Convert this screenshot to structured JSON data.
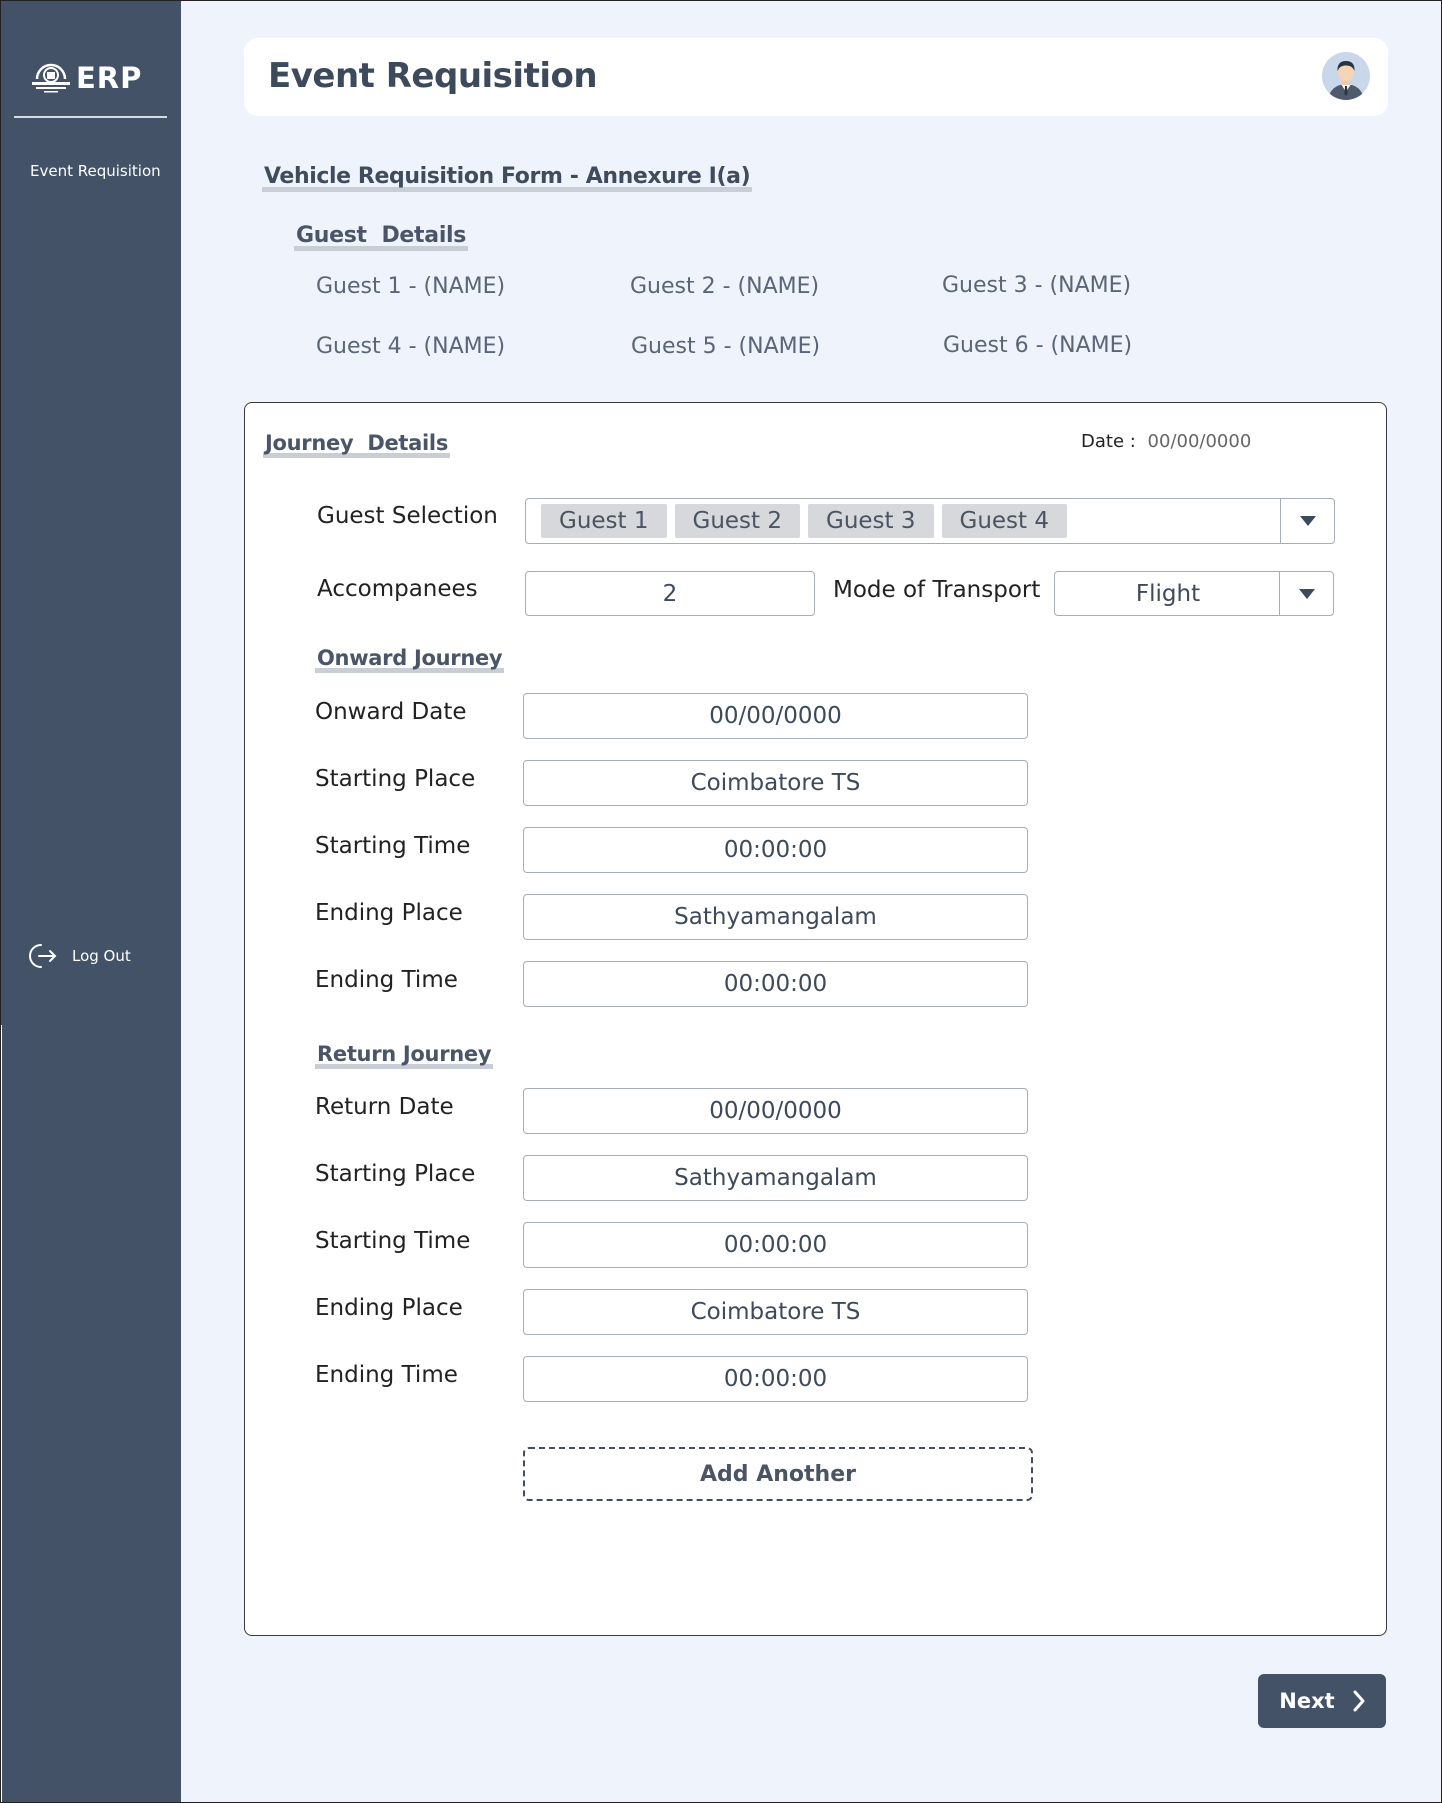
{
  "app": {
    "logo_text": "ERP"
  },
  "sidebar": {
    "items": [
      {
        "label": "Event Requisition"
      }
    ],
    "logout_label": "Log Out"
  },
  "header": {
    "title": "Event Requisition"
  },
  "form": {
    "title": "Vehicle Requisition Form - Annexure I(a)",
    "guest_details_heading": "Guest  Details",
    "guests": [
      "Guest 1 - (NAME)",
      "Guest 2 - (NAME)",
      "Guest 3 - (NAME)",
      "Guest 4 - (NAME)",
      "Guest 5 - (NAME)",
      "Guest 6 - (NAME)"
    ]
  },
  "journey": {
    "heading": "Journey  Details",
    "date_label": "Date :",
    "date_value": "00/00/0000",
    "guest_selection_label": "Guest Selection",
    "selected_guests": [
      "Guest 1",
      "Guest 2",
      "Guest 3",
      "Guest 4"
    ],
    "accompanees_label": "Accompanees",
    "accompanees_value": "2",
    "mode_label": "Mode of Transport",
    "mode_value": "Flight",
    "onward": {
      "heading": "Onward Journey",
      "date_label": "Onward Date",
      "date_value": "00/00/0000",
      "start_place_label": "Starting Place",
      "start_place_value": "Coimbatore TS",
      "start_time_label": "Starting Time",
      "start_time_value": "00:00:00",
      "end_place_label": "Ending Place",
      "end_place_value": "Sathyamangalam",
      "end_time_label": "Ending Time",
      "end_time_value": "00:00:00"
    },
    "return": {
      "heading": "Return Journey",
      "date_label": "Return Date",
      "date_value": "00/00/0000",
      "start_place_label": "Starting Place",
      "start_place_value": "Sathyamangalam",
      "start_time_label": "Starting Time",
      "start_time_value": "00:00:00",
      "end_place_label": "Ending Place",
      "end_place_value": "Coimbatore TS",
      "end_time_label": "Ending Time",
      "end_time_value": "00:00:00"
    },
    "add_another_label": "Add Another"
  },
  "footer": {
    "next_label": "Next"
  },
  "colors": {
    "sidebar": "#435266",
    "background": "#eff3fb",
    "accent": "#435266"
  }
}
